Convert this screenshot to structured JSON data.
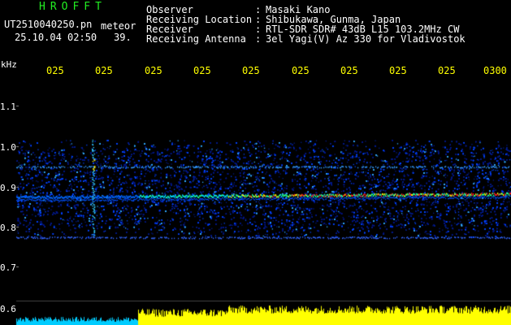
{
  "header": {
    "app_title": "HROFFT",
    "file_name": "UT2510040250.pn",
    "meteor_label": "meteor",
    "date_time": "25.10.04 02:50",
    "count": "39."
  },
  "station_info": [
    {
      "label": "Observer",
      "value": "Masaki Kano"
    },
    {
      "label": "Receiving Location",
      "value": "Shibukawa, Gunma, Japan"
    },
    {
      "label": "Receiver",
      "value": "RTL-SDR SDR# 43dB L15 103.2MHz CW"
    },
    {
      "label": "Receiving Antenna",
      "value": "3el Yagi(V) Az 330 for Vladivostok"
    }
  ],
  "colon": ":",
  "unit_label": "kHz",
  "time_axis": [
    "025",
    "025",
    "025",
    "025",
    "025",
    "025",
    "025",
    "025",
    "025",
    "0300"
  ],
  "freq_axis": [
    "1.1",
    "1.0",
    "0.9",
    "0.8",
    "0.7",
    "0.6"
  ],
  "colors": {
    "background": "#000000",
    "title": "#22ee22",
    "time_labels": "#ffff00",
    "noise": "#0044ff",
    "signal": "#ff2222",
    "amplitude_bars": "#ffff00",
    "amplitude_early": "#00ccff"
  }
}
